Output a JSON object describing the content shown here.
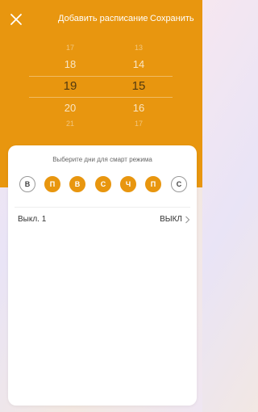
{
  "header": {
    "title": "Добавить расписание",
    "save_label": "Сохранить",
    "close_icon": "close-icon"
  },
  "picker": {
    "hours": [
      "17",
      "18",
      "19",
      "20",
      "21"
    ],
    "minutes": [
      "13",
      "14",
      "15",
      "16",
      "17"
    ],
    "selected_hour": "19",
    "selected_minute": "15"
  },
  "sheet": {
    "hint": "Выберите дни для смарт режима",
    "days": [
      {
        "label": "В",
        "selected": false
      },
      {
        "label": "П",
        "selected": true
      },
      {
        "label": "В",
        "selected": true
      },
      {
        "label": "С",
        "selected": true
      },
      {
        "label": "Ч",
        "selected": true
      },
      {
        "label": "П",
        "selected": true
      },
      {
        "label": "С",
        "selected": false
      }
    ],
    "row": {
      "label": "Выкл. 1",
      "value": "ВЫКЛ",
      "chevron_icon": "chevron-right-icon"
    }
  },
  "colors": {
    "accent": "#e8960f",
    "sheet_bg": "#ffffff"
  }
}
